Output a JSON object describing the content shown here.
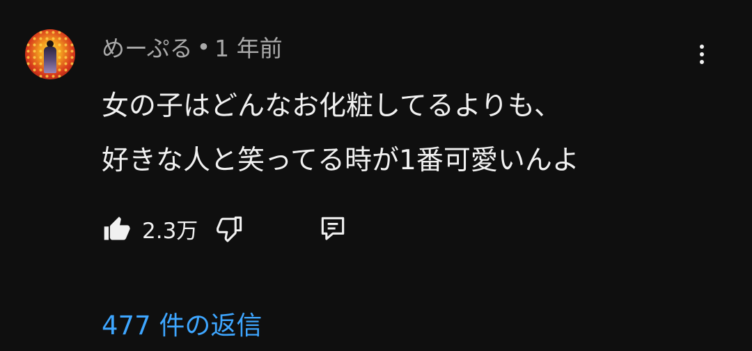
{
  "comment": {
    "author": "めーぷる",
    "separator": "•",
    "time": "1 年前",
    "lines": [
      "女の子はどんなお化粧してるよりも、",
      "好きな人と笑ってる時が1番可愛いんよ"
    ],
    "like_count": "2.3万",
    "replies_label": "477 件の返信"
  },
  "icons": {
    "avatar": "avatar-image",
    "menu": "more-vert-icon",
    "like": "thumb-up-icon",
    "dislike": "thumb-down-icon",
    "reply": "reply-comment-icon"
  },
  "colors": {
    "background": "#0f0f0f",
    "primary_text": "#f1f1f1",
    "secondary_text": "#aaaaaa",
    "link": "#3ea6ff"
  }
}
